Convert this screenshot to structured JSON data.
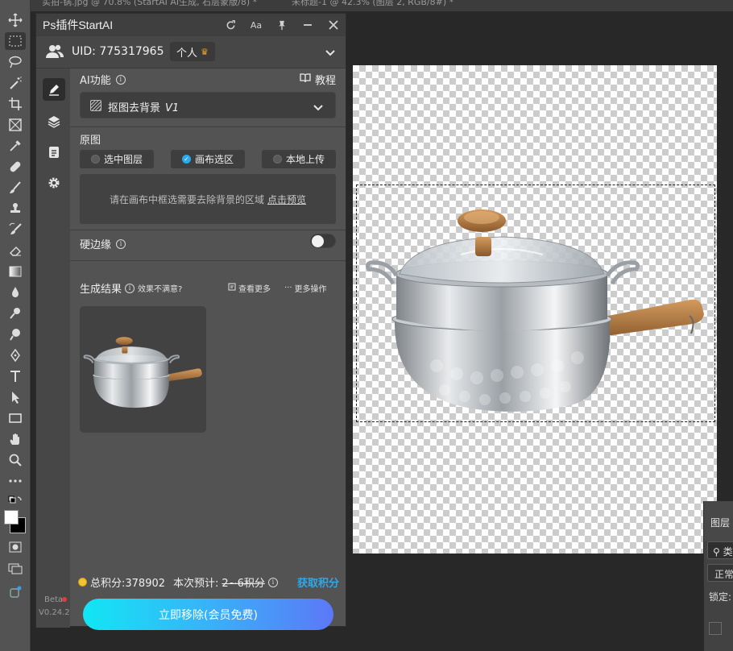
{
  "doc_tabs": [
    {
      "label": "实拍-锅.jpg @ 70.8% (StartAI AI生成, 石层蒙版/8) *"
    },
    {
      "label": "未标题-1 @ 42.3% (图层 2, RGB/8#) *"
    }
  ],
  "plugin": {
    "title": "Ps插件StartAI",
    "user": {
      "uid_label": "UID: 775317965",
      "plan": "个人"
    },
    "ai_function": {
      "label": "AI功能",
      "tutorial": "教程",
      "mode": "抠图去背景",
      "mode_version": "V1"
    },
    "source": {
      "label": "原图",
      "options": [
        {
          "label": "选中图层",
          "selected": false
        },
        {
          "label": "画布选区",
          "selected": true
        },
        {
          "label": "本地上传",
          "selected": false
        }
      ],
      "hint": "请在画布中框选需要去除背景的区域",
      "hint_link": "点击预览"
    },
    "hard_edge": {
      "label": "硬边缘",
      "enabled": false
    },
    "result": {
      "label": "生成结果",
      "dissatisfied": "效果不满意?",
      "view_more": "查看更多",
      "more_actions": "更多操作"
    },
    "footer": {
      "total_points": "总积分:378902",
      "estimate_label": "本次预计:",
      "estimate_value": "2~6积分",
      "get_points": "获取积分",
      "cta": "立即移除(会员免费)"
    },
    "beta": "Beta",
    "version": "V0.24.2"
  },
  "layers_panel": {
    "tab": "图层",
    "search_prefix": "类",
    "blend_mode": "正常",
    "lock_label": "锁定:"
  },
  "colors": {
    "accent": "#29a9ef",
    "cta_start": "#12e6f4",
    "cta_end": "#5c78f7",
    "coin": "#f2c430"
  }
}
